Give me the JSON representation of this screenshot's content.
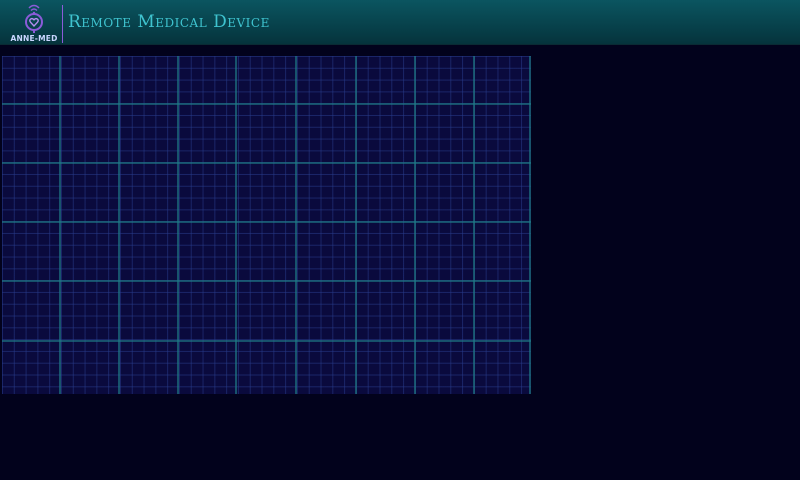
{
  "app": {
    "title": "Remote Medical Device",
    "logo_text": "ANNE-MED"
  },
  "icons": {
    "logo": "stethoscope-wifi-icon"
  },
  "colors": {
    "background": "#02021c",
    "header": "#084650",
    "title": "#3fc3cf",
    "grid_major": "#1f7b86",
    "grid_minor": "#283c8c",
    "logo_accent": "#8b5bd9"
  }
}
